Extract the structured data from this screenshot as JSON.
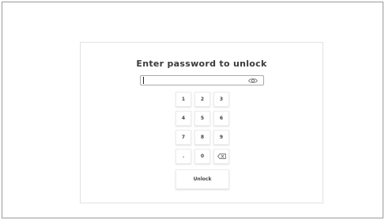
{
  "dialog": {
    "title": "Enter password to unlock"
  },
  "password_field": {
    "value": "",
    "show_password_icon": "eye-icon"
  },
  "keypad": {
    "keys": [
      "1",
      "2",
      "3",
      "4",
      "5",
      "6",
      "7",
      "8",
      "9",
      ".",
      "0"
    ],
    "backspace_icon": "backspace-icon"
  },
  "unlock_button": {
    "label": "Unlock"
  },
  "colors": {
    "text": "#444444",
    "border": "#aaaaaa",
    "background": "#ffffff"
  }
}
